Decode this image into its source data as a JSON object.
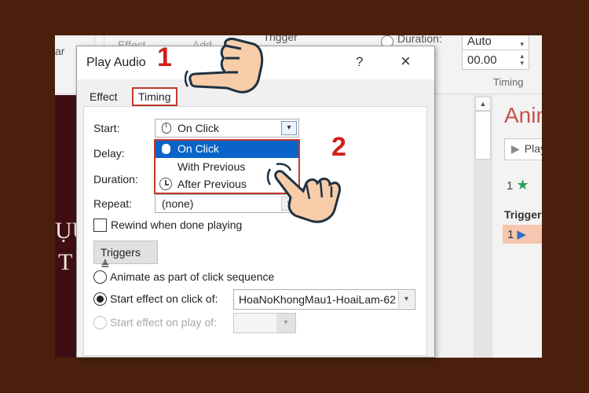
{
  "ribbon": {
    "left_fragment": "ar",
    "effect_fragment": "Effect",
    "add_fragment": "Add",
    "trigger_fragment": "Trigger",
    "duration_label": "Duration:",
    "duration_value": "Auto",
    "delay_value": "00.00",
    "group_label": "Timing"
  },
  "slide": {
    "glyphs": [
      "ỤỤ",
      "T"
    ]
  },
  "animation_pane": {
    "title": "Animation Pane",
    "play_label": "Play",
    "item_number": "1",
    "triggers_label": "Trigger",
    "trigger_item_number": "1",
    "accent_color": "#c9504a"
  },
  "dialog": {
    "title": "Play Audio",
    "help": "?",
    "close": "×",
    "tabs": [
      {
        "label": "Effect",
        "active": false
      },
      {
        "label": "Timing",
        "active": true
      }
    ],
    "start": {
      "label": "Start:",
      "value": "On Click"
    },
    "start_options": [
      {
        "label": "On Click",
        "icon": "mouse-icon",
        "selected": true
      },
      {
        "label": "With Previous",
        "icon": "",
        "selected": false
      },
      {
        "label": "After Previous",
        "icon": "clock-icon",
        "selected": false
      }
    ],
    "delay": {
      "label": "Delay:"
    },
    "duration": {
      "label": "Duration:"
    },
    "repeat": {
      "label": "Repeat:",
      "value": "(none)"
    },
    "rewind": {
      "label": "Rewind when done playing",
      "checked": false
    },
    "triggers_button": "Triggers",
    "triggers_button_icon": "≜",
    "radio_animate": {
      "label": "Animate as part of click sequence",
      "selected": false
    },
    "radio_click": {
      "label": "Start effect on click of:",
      "selected": true,
      "value": "HoaNoKhongMau1-HoaiLam-62"
    },
    "radio_play": {
      "label": "Start effect on play of:",
      "selected": false,
      "enabled": false
    }
  },
  "annotations": {
    "step1": "1",
    "step2": "2",
    "highlight_color": "#c0392b",
    "selection_color": "#0a64c8"
  }
}
